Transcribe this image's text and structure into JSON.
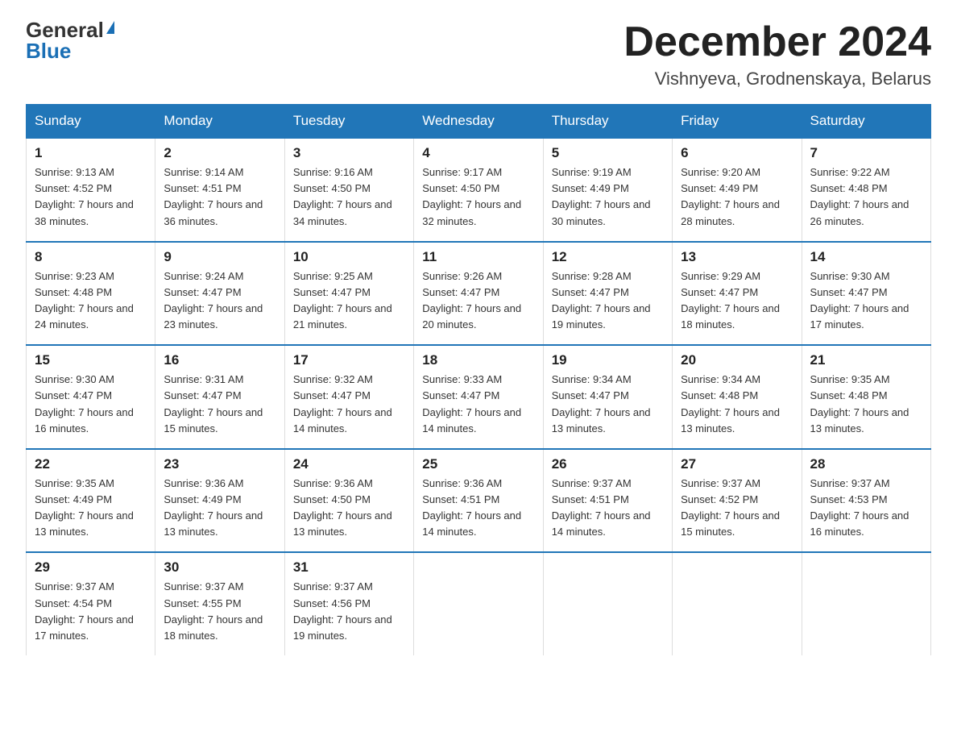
{
  "logo": {
    "general": "General",
    "blue": "Blue"
  },
  "header": {
    "month": "December 2024",
    "location": "Vishnyeva, Grodnenskaya, Belarus"
  },
  "weekdays": [
    "Sunday",
    "Monday",
    "Tuesday",
    "Wednesday",
    "Thursday",
    "Friday",
    "Saturday"
  ],
  "weeks": [
    [
      {
        "day": "1",
        "sunrise": "9:13 AM",
        "sunset": "4:52 PM",
        "daylight": "7 hours and 38 minutes."
      },
      {
        "day": "2",
        "sunrise": "9:14 AM",
        "sunset": "4:51 PM",
        "daylight": "7 hours and 36 minutes."
      },
      {
        "day": "3",
        "sunrise": "9:16 AM",
        "sunset": "4:50 PM",
        "daylight": "7 hours and 34 minutes."
      },
      {
        "day": "4",
        "sunrise": "9:17 AM",
        "sunset": "4:50 PM",
        "daylight": "7 hours and 32 minutes."
      },
      {
        "day": "5",
        "sunrise": "9:19 AM",
        "sunset": "4:49 PM",
        "daylight": "7 hours and 30 minutes."
      },
      {
        "day": "6",
        "sunrise": "9:20 AM",
        "sunset": "4:49 PM",
        "daylight": "7 hours and 28 minutes."
      },
      {
        "day": "7",
        "sunrise": "9:22 AM",
        "sunset": "4:48 PM",
        "daylight": "7 hours and 26 minutes."
      }
    ],
    [
      {
        "day": "8",
        "sunrise": "9:23 AM",
        "sunset": "4:48 PM",
        "daylight": "7 hours and 24 minutes."
      },
      {
        "day": "9",
        "sunrise": "9:24 AM",
        "sunset": "4:47 PM",
        "daylight": "7 hours and 23 minutes."
      },
      {
        "day": "10",
        "sunrise": "9:25 AM",
        "sunset": "4:47 PM",
        "daylight": "7 hours and 21 minutes."
      },
      {
        "day": "11",
        "sunrise": "9:26 AM",
        "sunset": "4:47 PM",
        "daylight": "7 hours and 20 minutes."
      },
      {
        "day": "12",
        "sunrise": "9:28 AM",
        "sunset": "4:47 PM",
        "daylight": "7 hours and 19 minutes."
      },
      {
        "day": "13",
        "sunrise": "9:29 AM",
        "sunset": "4:47 PM",
        "daylight": "7 hours and 18 minutes."
      },
      {
        "day": "14",
        "sunrise": "9:30 AM",
        "sunset": "4:47 PM",
        "daylight": "7 hours and 17 minutes."
      }
    ],
    [
      {
        "day": "15",
        "sunrise": "9:30 AM",
        "sunset": "4:47 PM",
        "daylight": "7 hours and 16 minutes."
      },
      {
        "day": "16",
        "sunrise": "9:31 AM",
        "sunset": "4:47 PM",
        "daylight": "7 hours and 15 minutes."
      },
      {
        "day": "17",
        "sunrise": "9:32 AM",
        "sunset": "4:47 PM",
        "daylight": "7 hours and 14 minutes."
      },
      {
        "day": "18",
        "sunrise": "9:33 AM",
        "sunset": "4:47 PM",
        "daylight": "7 hours and 14 minutes."
      },
      {
        "day": "19",
        "sunrise": "9:34 AM",
        "sunset": "4:47 PM",
        "daylight": "7 hours and 13 minutes."
      },
      {
        "day": "20",
        "sunrise": "9:34 AM",
        "sunset": "4:48 PM",
        "daylight": "7 hours and 13 minutes."
      },
      {
        "day": "21",
        "sunrise": "9:35 AM",
        "sunset": "4:48 PM",
        "daylight": "7 hours and 13 minutes."
      }
    ],
    [
      {
        "day": "22",
        "sunrise": "9:35 AM",
        "sunset": "4:49 PM",
        "daylight": "7 hours and 13 minutes."
      },
      {
        "day": "23",
        "sunrise": "9:36 AM",
        "sunset": "4:49 PM",
        "daylight": "7 hours and 13 minutes."
      },
      {
        "day": "24",
        "sunrise": "9:36 AM",
        "sunset": "4:50 PM",
        "daylight": "7 hours and 13 minutes."
      },
      {
        "day": "25",
        "sunrise": "9:36 AM",
        "sunset": "4:51 PM",
        "daylight": "7 hours and 14 minutes."
      },
      {
        "day": "26",
        "sunrise": "9:37 AM",
        "sunset": "4:51 PM",
        "daylight": "7 hours and 14 minutes."
      },
      {
        "day": "27",
        "sunrise": "9:37 AM",
        "sunset": "4:52 PM",
        "daylight": "7 hours and 15 minutes."
      },
      {
        "day": "28",
        "sunrise": "9:37 AM",
        "sunset": "4:53 PM",
        "daylight": "7 hours and 16 minutes."
      }
    ],
    [
      {
        "day": "29",
        "sunrise": "9:37 AM",
        "sunset": "4:54 PM",
        "daylight": "7 hours and 17 minutes."
      },
      {
        "day": "30",
        "sunrise": "9:37 AM",
        "sunset": "4:55 PM",
        "daylight": "7 hours and 18 minutes."
      },
      {
        "day": "31",
        "sunrise": "9:37 AM",
        "sunset": "4:56 PM",
        "daylight": "7 hours and 19 minutes."
      },
      null,
      null,
      null,
      null
    ]
  ]
}
